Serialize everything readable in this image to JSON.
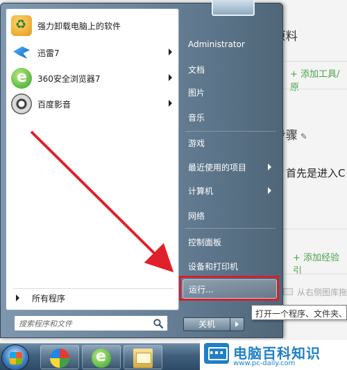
{
  "background": {
    "section_title": "工具/原料",
    "add_tool_link": "+ 添加工具/原",
    "steps_title": "方法/步骤",
    "step_text": "首先是进入C",
    "add_experience_link": "+ 添加经验引",
    "gray_note": "从右侧图库拖"
  },
  "start_menu": {
    "programs": [
      {
        "label": "强力卸载电脑上的软件",
        "icon": "uninstall-icon",
        "has_submenu": false
      },
      {
        "label": "迅雷7",
        "icon": "thunder-icon",
        "has_submenu": true
      },
      {
        "label": "360安全浏览器7",
        "icon": "360-browser-icon",
        "has_submenu": true
      },
      {
        "label": "百度影音",
        "icon": "baidu-player-icon",
        "has_submenu": true
      }
    ],
    "all_programs": "所有程序",
    "search": {
      "placeholder": "搜索程序和文件"
    },
    "right_items": [
      {
        "label": "Administrator",
        "has_submenu": false
      },
      {
        "label": "文档",
        "has_submenu": false
      },
      {
        "label": "图片",
        "has_submenu": false
      },
      {
        "label": "音乐",
        "has_submenu": false
      },
      {
        "label": "游戏",
        "has_submenu": false
      },
      {
        "label": "最近使用的项目",
        "has_submenu": true
      },
      {
        "label": "计算机",
        "has_submenu": true
      },
      {
        "label": "网络",
        "has_submenu": false
      },
      {
        "label": "控制面板",
        "has_submenu": false
      },
      {
        "label": "设备和打印机",
        "has_submenu": false
      },
      {
        "label": "运行...",
        "has_submenu": false,
        "highlighted": true
      }
    ],
    "shutdown_label": "关机",
    "tooltip": "打开一个程序、文件夹、文"
  },
  "taskbar": {
    "icons": [
      "pinwheel-icon",
      "360-browser-icon",
      "folder-icon"
    ]
  },
  "watermark": {
    "title": "电脑百科知识",
    "url": "www.pc-daily.com"
  },
  "colors": {
    "highlight_border": "#d3202c",
    "annotation_arrow": "#e0202a",
    "accent_green": "#4aa34a",
    "watermark_blue": "#1f7fc7"
  }
}
